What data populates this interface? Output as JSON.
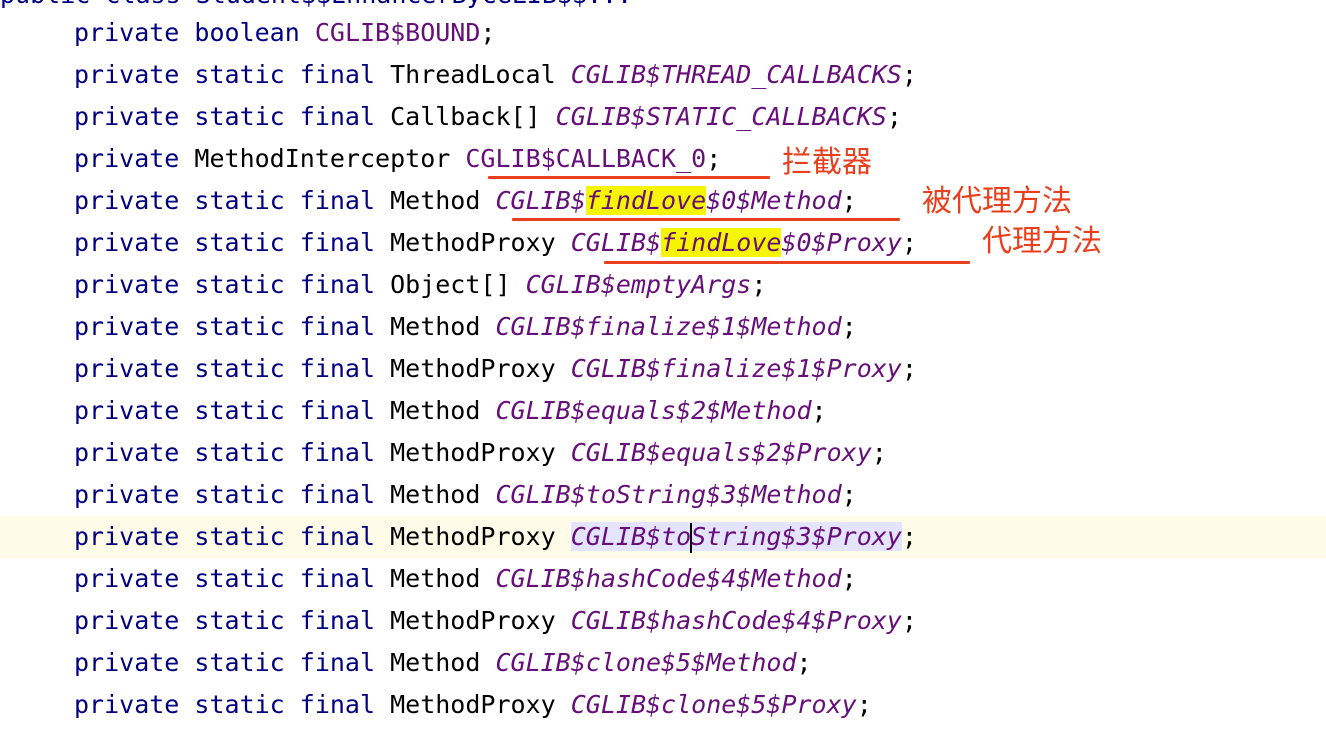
{
  "partial_top_line": "public class Student$$EnhancerByCGLIB$$...",
  "lines": [
    {
      "mods": "private",
      "type": "boolean",
      "field": "CGLIB$BOUND",
      "semi": ";"
    },
    {
      "mods": "private static final",
      "type": "ThreadLocal",
      "field": "CGLIB$THREAD_CALLBACKS",
      "semi": ";"
    },
    {
      "mods": "private static final",
      "type": "Callback[]",
      "field": "CGLIB$STATIC_CALLBACKS",
      "semi": ";"
    },
    {
      "mods": "private",
      "type": "MethodInterceptor",
      "field": "CGLIB$CALLBACK_0",
      "semi": ";"
    },
    {
      "mods": "private static final",
      "type": "Method",
      "field_a": "CGLIB$",
      "field_hl": "findLove",
      "field_b": "$0$Method",
      "semi": ";"
    },
    {
      "mods": "private static final",
      "type": "MethodProxy",
      "field_a": "CGLIB$",
      "field_hl": "findLove",
      "field_b": "$0$Proxy",
      "semi": ";"
    },
    {
      "mods": "private static final",
      "type": "Object[]",
      "field": "CGLIB$emptyArgs",
      "semi": ";"
    },
    {
      "mods": "private static final",
      "type": "Method",
      "field": "CGLIB$finalize$1$Method",
      "semi": ";"
    },
    {
      "mods": "private static final",
      "type": "MethodProxy",
      "field": "CGLIB$finalize$1$Proxy",
      "semi": ";"
    },
    {
      "mods": "private static final",
      "type": "Method",
      "field": "CGLIB$equals$2$Method",
      "semi": ";"
    },
    {
      "mods": "private static final",
      "type": "MethodProxy",
      "field": "CGLIB$equals$2$Proxy",
      "semi": ";"
    },
    {
      "mods": "private static final",
      "type": "Method",
      "field": "CGLIB$toString$3$Method",
      "semi": ";"
    },
    {
      "mods": "private static final",
      "type": "MethodProxy",
      "field_a": "CGLIB$to",
      "field_b": "String$3$Proxy",
      "semi": ";"
    },
    {
      "mods": "private static final",
      "type": "Method",
      "field": "CGLIB$hashCode$4$Method",
      "semi": ";"
    },
    {
      "mods": "private static final",
      "type": "MethodProxy",
      "field": "CGLIB$hashCode$4$Proxy",
      "semi": ";"
    },
    {
      "mods": "private static final",
      "type": "Method",
      "field": "CGLIB$clone$5$Method",
      "semi": ";"
    },
    {
      "mods": "private static final",
      "type": "MethodProxy",
      "field": "CGLIB$clone$5$Proxy",
      "semi": ";"
    }
  ],
  "annotations": {
    "interceptor": "拦截器",
    "proxied_method": "被代理方法",
    "proxy_method": "代理方法"
  },
  "colors": {
    "keyword": "#000080",
    "field": "#660e7a",
    "annotation": "#e8401c",
    "highlight": "#f5f500",
    "selection": "#e4e4ff",
    "current_line": "#fefbe8"
  }
}
